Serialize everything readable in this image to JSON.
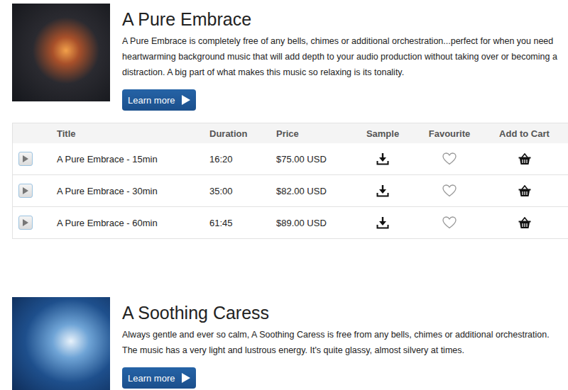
{
  "albums": [
    {
      "title": "A Pure Embrace",
      "description": "A Pure Embrace is completely free of any bells, chimes or additional orchestration...perfect for when you need heartwarming background music that will add depth to your audio production without taking over or becoming a distraction. A big part of what makes this music so relaxing is its tonality.",
      "button": "Learn more",
      "table": {
        "columns": [
          "Title",
          "Duration",
          "Price",
          "Sample",
          "Favourite",
          "Add to Cart"
        ],
        "rows": [
          {
            "title": "A Pure Embrace - 15min",
            "duration": "16:20",
            "price": "$75.00 USD",
            "favourite": false
          },
          {
            "title": "A Pure Embrace - 30min",
            "duration": "35:00",
            "price": "$82.00 USD",
            "favourite": false
          },
          {
            "title": "A Pure Embrace - 60min",
            "duration": "61:45",
            "price": "$89.00 USD",
            "favourite": false
          }
        ]
      }
    },
    {
      "title": "A Soothing Caress",
      "description": "Always gentle and ever so calm, A Soothing Caress is free from any bells, chimes or additional orchestration. The music has a very light and lustrous energy. It's quite glassy, almost silvery at times.",
      "button": "Learn more",
      "table": null
    }
  ]
}
